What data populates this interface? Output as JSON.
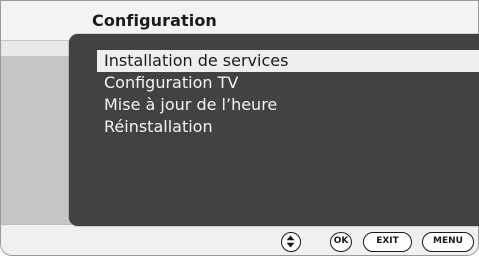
{
  "header": {
    "title": "Configuration"
  },
  "menu": {
    "items": [
      {
        "label": "Installation de services",
        "selected": true
      },
      {
        "label": "Configuration TV",
        "selected": false
      },
      {
        "label": "Mise à jour de l’heure",
        "selected": false
      },
      {
        "label": "Réinstallation",
        "selected": false
      }
    ]
  },
  "footer": {
    "nav_icon": "up-down-navigation-icon",
    "ok_label": "OK",
    "exit_label": "EXIT",
    "menu_label": "MENU"
  },
  "colors": {
    "panel": "#424242",
    "highlight": "#eeeeee",
    "band": "#c6c6c6",
    "background": "#e9e9e9"
  }
}
